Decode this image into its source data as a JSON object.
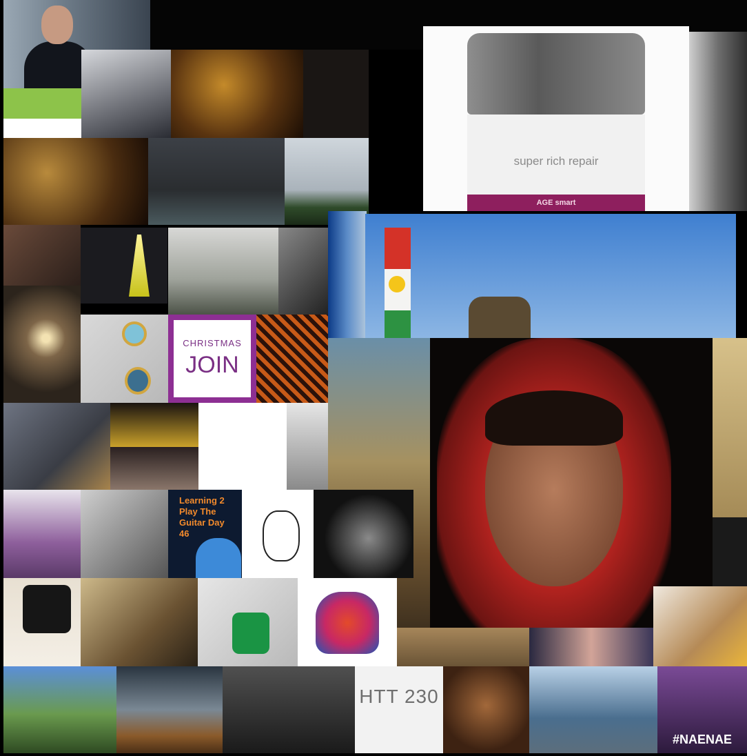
{
  "collage": {
    "background": "#000000",
    "cream_label": "super rich repair",
    "cream_brand": "AGE smart",
    "christmas_card": {
      "line1": "CHRISTMAS",
      "line2": "JOIN"
    },
    "guitar_title": "Learning 2 Play The Guitar Day 46",
    "htt_label": "HTT 230",
    "naenae_label": "#NAENAE"
  }
}
